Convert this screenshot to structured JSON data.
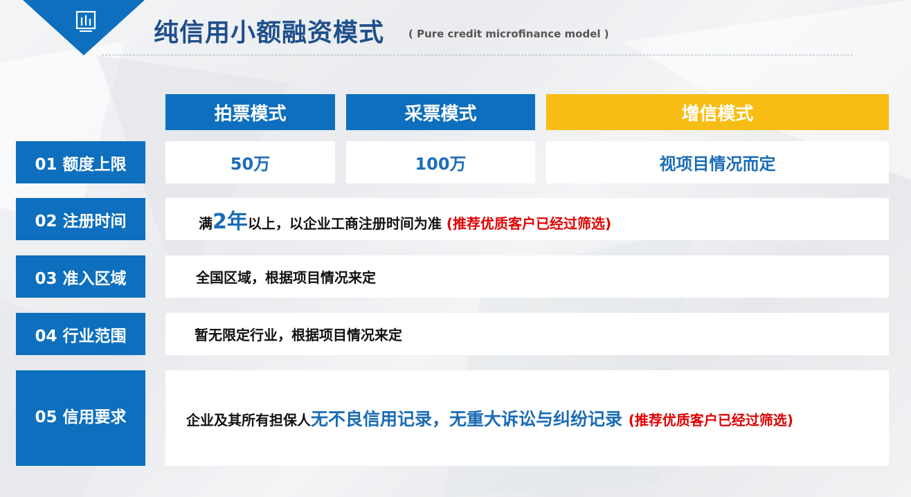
{
  "header": {
    "title": "纯信用小额融资模式",
    "subtitle": "( Pure credit microfinance model )"
  },
  "columns": [
    {
      "label": "拍票模式",
      "color": "#0d6fbd"
    },
    {
      "label": "采票模式",
      "color": "#0d6fbd"
    },
    {
      "label": "增信模式",
      "color": "#f7bd14"
    }
  ],
  "rows": [
    {
      "label": "01 额度上限",
      "values": [
        "50万",
        "100万",
        "视项目情况而定"
      ]
    },
    {
      "label": "02 注册时间",
      "pre": "满",
      "highlight": "2年",
      "post": "以上，以企业工商注册时间为准 ",
      "note": "(推荐优质客户已经过筛选)"
    },
    {
      "label": "03 准入区域",
      "text": "全国区域，根据项目情况来定"
    },
    {
      "label": "04 行业范围",
      "text": "暂无限定行业，根据项目情况来定"
    },
    {
      "label": "05 信用要求",
      "pre": "企业及其所有担保人",
      "highlight": "无不良信用记录，无重大诉讼与纠纷记录 ",
      "note": "(推荐优质客户已经过筛选)"
    }
  ],
  "colors": {
    "primary": "#0d6fbd",
    "accent": "#f7bd14",
    "title": "#1f4f8c",
    "highlight": "#1b6cb5",
    "note": "#e00000"
  },
  "icons": {
    "corner": "bar-chart-icon"
  }
}
